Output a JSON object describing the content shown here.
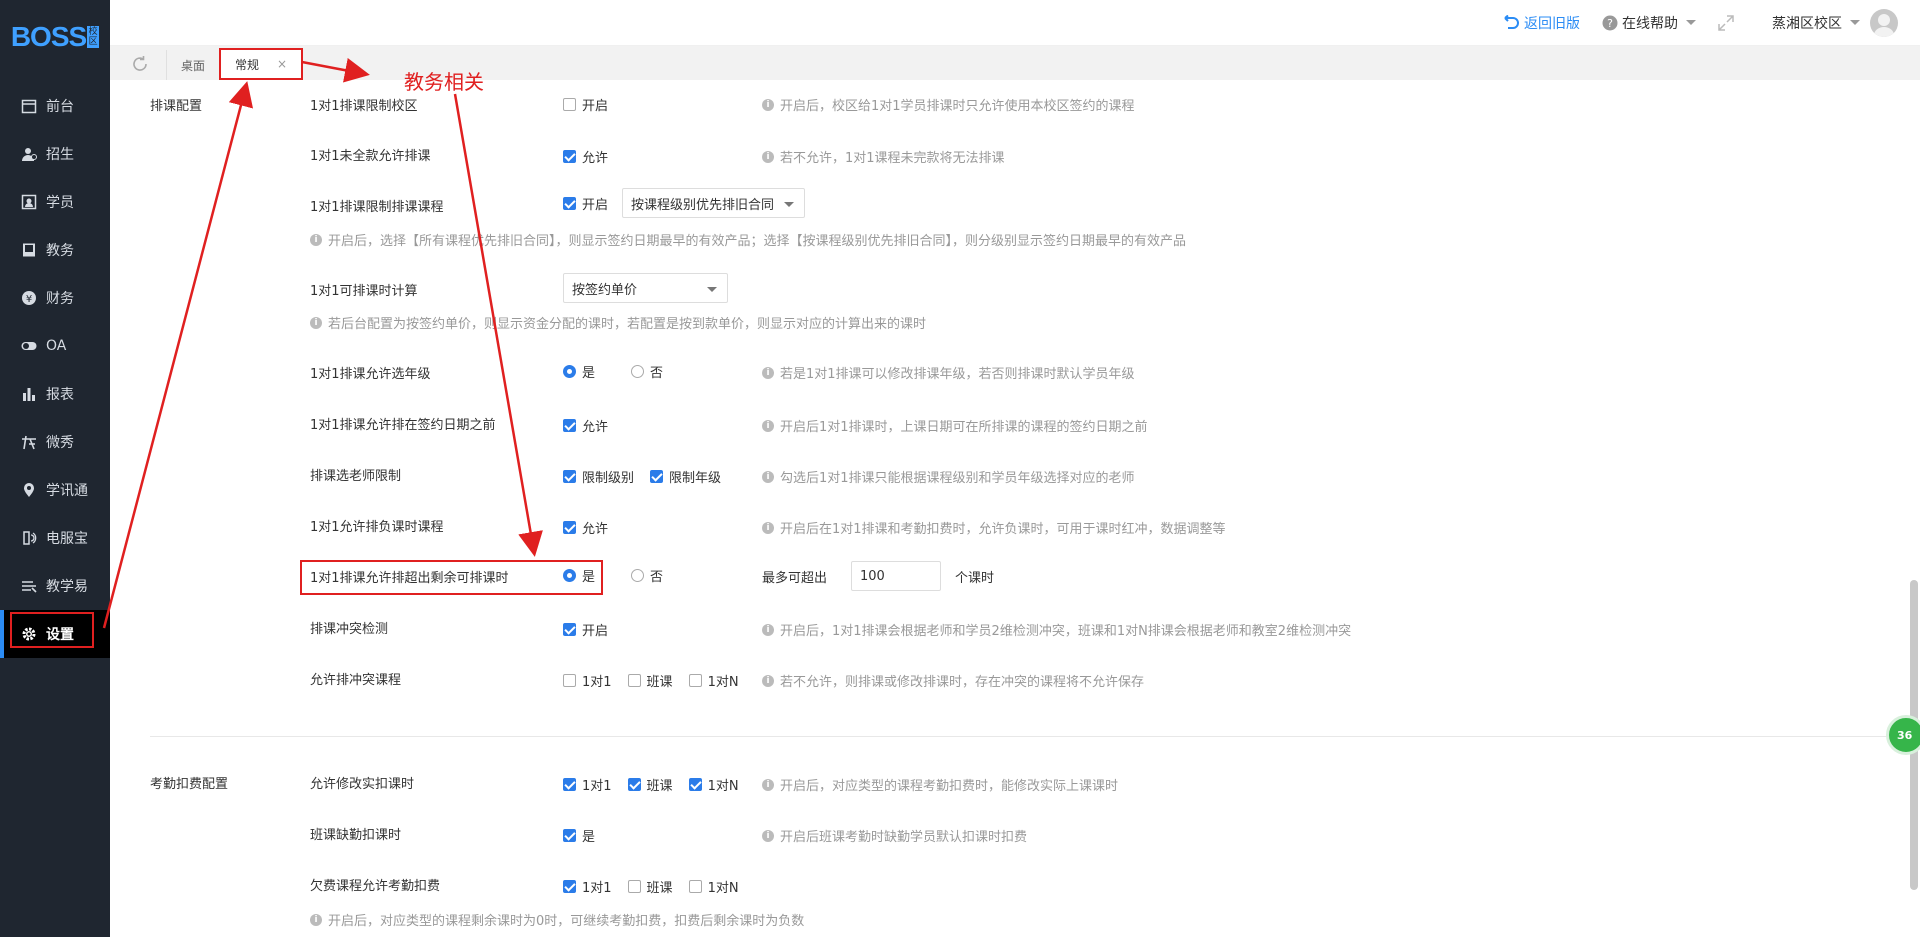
{
  "brand": {
    "logo": "BOSS",
    "badge": "校区"
  },
  "sidebar": {
    "items": [
      {
        "label": "前台",
        "icon": "calendar-icon"
      },
      {
        "label": "招生",
        "icon": "user-add-icon"
      },
      {
        "label": "学员",
        "icon": "id-card-icon"
      },
      {
        "label": "教务",
        "icon": "book-icon"
      },
      {
        "label": "财务",
        "icon": "yen-icon"
      },
      {
        "label": "OA",
        "icon": "toggle-icon"
      },
      {
        "label": "报表",
        "icon": "bar-chart-icon"
      },
      {
        "label": "微秀",
        "icon": "wechat-show-icon"
      },
      {
        "label": "学讯通",
        "icon": "location-pin-icon"
      },
      {
        "label": "电服宝",
        "icon": "phone-service-icon"
      },
      {
        "label": "教学易",
        "icon": "teaching-icon"
      },
      {
        "label": "设置",
        "icon": "gear-icon",
        "active": true
      }
    ]
  },
  "topbar": {
    "back_old": "返回旧版",
    "help": "在线帮助",
    "campus": "蒸湘区校区"
  },
  "tabs": [
    {
      "label": "桌面",
      "active": false
    },
    {
      "label": "常规",
      "active": true,
      "close": "×"
    }
  ],
  "annotation": {
    "text": "教务相关"
  },
  "scheduling": {
    "section_label": "排课配置",
    "rows": {
      "r1": {
        "label": "1对1排课限制校区",
        "opt1": "开启",
        "hint": "开启后，校区给1对1学员排课时只允许使用本校区签约的课程"
      },
      "r2": {
        "label": "1对1未全款允许排课",
        "opt1": "允许",
        "hint": "若不允许，1对1课程未完款将无法排课"
      },
      "r3": {
        "label": "1对1排课限制排课课程",
        "opt1": "开启",
        "select": "按课程级别优先排旧合同",
        "hint": "开启后，选择【所有课程优先排旧合同】，则显示签约日期最早的有效产品；选择【按课程级别优先排旧合同】，则分级别显示签约日期最早的有效产品"
      },
      "r4": {
        "label": "1对1可排课时计算",
        "select": "按签约单价",
        "hint": "若后台配置为按签约单价，则显示资金分配的课时，若配置是按到款单价，则显示对应的计算出来的课时"
      },
      "r5": {
        "label": "1对1排课允许选年级",
        "opt1": "是",
        "opt2": "否",
        "hint": "若是1对1排课可以修改排课年级，若否则排课时默认学员年级"
      },
      "r6": {
        "label": "1对1排课允许排在签约日期之前",
        "opt1": "允许",
        "hint": "开启后1对1排课时，上课日期可在所排课的课程的签约日期之前"
      },
      "r7": {
        "label": "排课选老师限制",
        "opt1": "限制级别",
        "opt2": "限制年级",
        "hint": "勾选后1对1排课只能根据课程级别和学员年级选择对应的老师"
      },
      "r8": {
        "label": "1对1允许排负课时课程",
        "opt1": "允许",
        "hint": "开启后在1对1排课和考勤扣费时，允许负课时，可用于课时红冲，数据调整等"
      },
      "r9": {
        "label": "1对1排课允许排超出剩余可排课时",
        "opt1": "是",
        "opt2": "否",
        "extra_label": "最多可超出",
        "input_value": "100",
        "unit": "个课时"
      },
      "r10": {
        "label": "排课冲突检测",
        "opt1": "开启",
        "hint": "开启后，1对1排课会根据老师和学员2维检测冲突，班课和1对N排课会根据老师和教室2维检测冲突"
      },
      "r11": {
        "label": "允许排冲突课程",
        "opt1": "1对1",
        "opt2": "班课",
        "opt3": "1对N",
        "hint": "若不允许，则排课或修改排课时，存在冲突的课程将不允许保存"
      }
    }
  },
  "attendance": {
    "section_label": "考勤扣费配置",
    "rows": {
      "a1": {
        "label": "允许修改实扣课时",
        "opt1": "1对1",
        "opt2": "班课",
        "opt3": "1对N",
        "hint": "开启后，对应类型的课程考勤扣费时，能修改实际上课课时"
      },
      "a2": {
        "label": "班课缺勤扣课时",
        "opt1": "是",
        "hint": "开启后班课考勤时缺勤学员默认扣课时扣费"
      },
      "a3": {
        "label": "欠费课程允许考勤扣费",
        "opt1": "1对1",
        "opt2": "班课",
        "opt3": "1对N",
        "hint": "开启后，对应类型的课程剩余课时为0时，可继续考勤扣费，扣费后剩余课时为负数"
      }
    }
  },
  "float_badge": "36",
  "colors": {
    "accent": "#2b7ce9",
    "annotation": "#e02020",
    "sidebar": "#1f2630"
  }
}
